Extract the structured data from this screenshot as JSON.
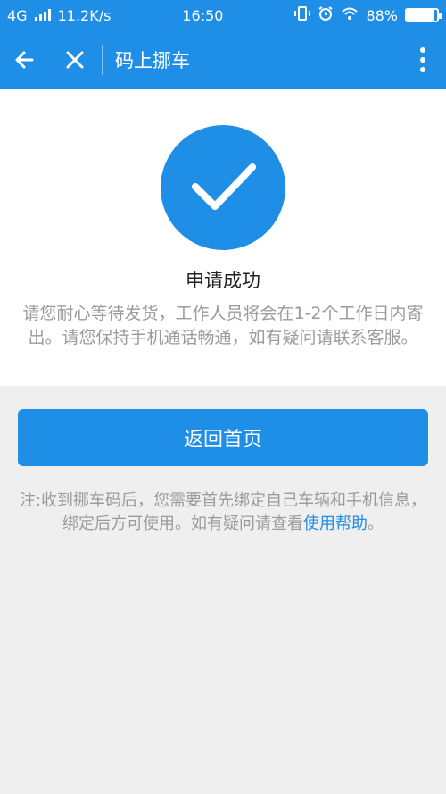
{
  "status_bar": {
    "network": "4G",
    "speed": "11.2K/s",
    "time": "16:50",
    "battery": "88%",
    "battery_level": 0.88
  },
  "app_bar": {
    "title": "码上挪车",
    "back_icon": "arrow-left-icon",
    "close_icon": "close-icon",
    "more_icon": "more-vertical-icon"
  },
  "result": {
    "icon": "check-icon",
    "title": "申请成功",
    "message": "请您耐心等待发货，工作人员将会在1-2个工作日内寄出。请您保持手机通话畅通，如有疑问请联系客服。"
  },
  "actions": {
    "home_button": "返回首页"
  },
  "note": {
    "text": "注:收到挪车码后，您需要首先绑定自己车辆和手机信息，绑定后方可使用。如有疑问请查看",
    "link": "使用帮助",
    "suffix": "。"
  },
  "colors": {
    "primary": "#1f8ee6",
    "background": "#efefef",
    "muted_text": "#9b9b9b"
  }
}
